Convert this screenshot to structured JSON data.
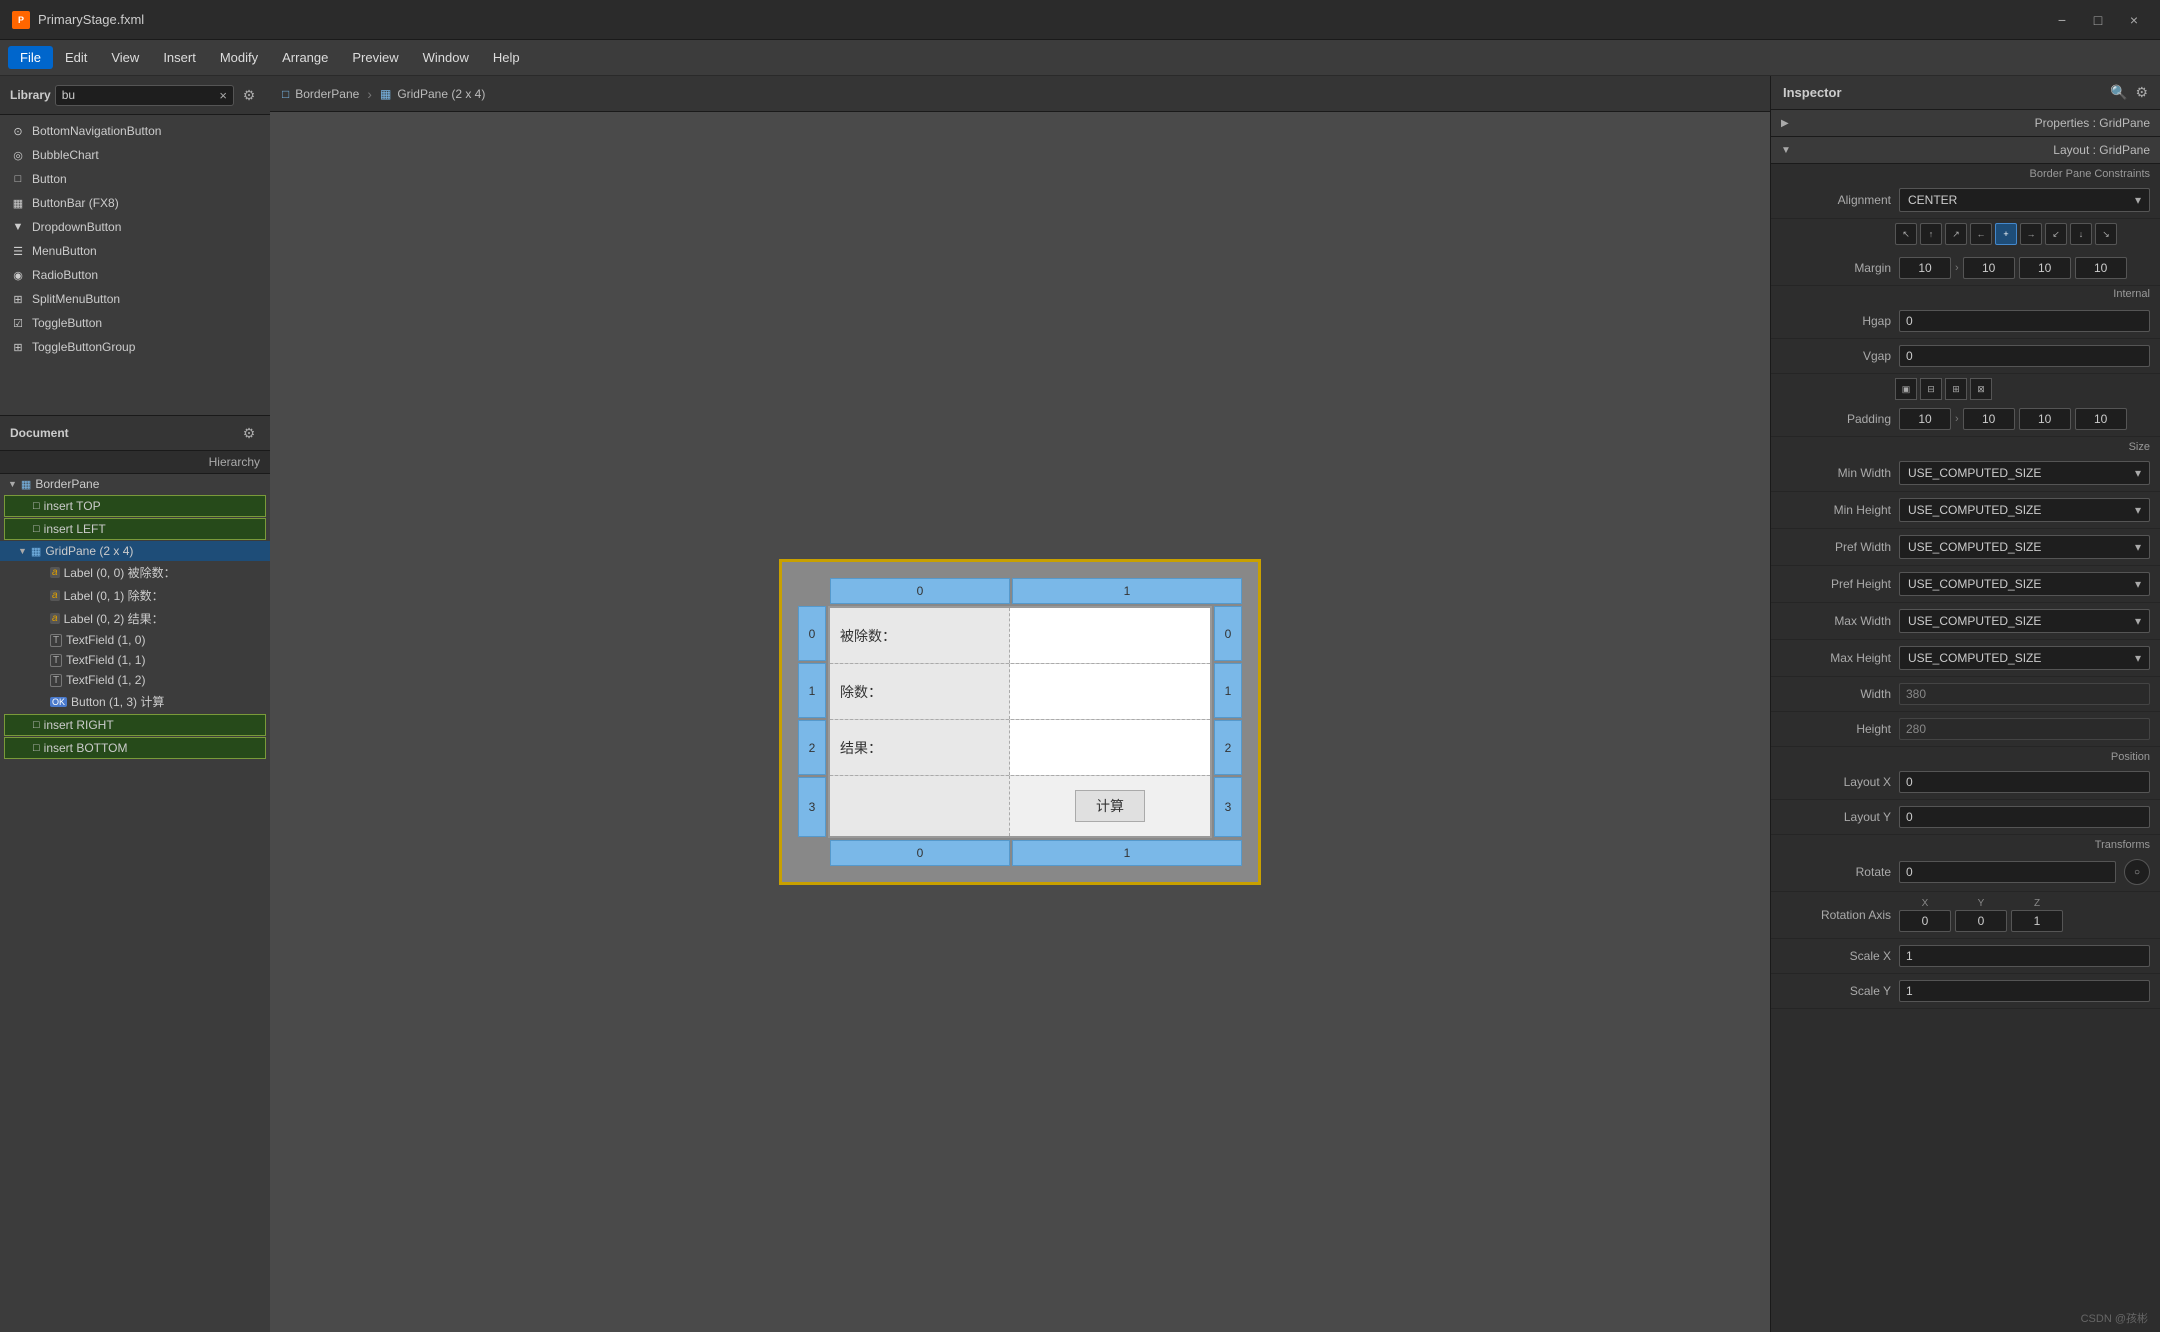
{
  "titlebar": {
    "title": "PrimaryStage.fxml",
    "icon": "P",
    "min_label": "−",
    "max_label": "□",
    "close_label": "×"
  },
  "menubar": {
    "items": [
      "File",
      "Edit",
      "View",
      "Insert",
      "Modify",
      "Arrange",
      "Preview",
      "Window",
      "Help"
    ],
    "active": "File"
  },
  "library": {
    "panel_title": "Library",
    "search_placeholder": "bu",
    "items": [
      {
        "icon": "⊙",
        "label": "BottomNavigationButton"
      },
      {
        "icon": "◎",
        "label": "BubbleChart"
      },
      {
        "icon": "□",
        "label": "Button"
      },
      {
        "icon": "▦",
        "label": "ButtonBar  (FX8)"
      },
      {
        "icon": "▼",
        "label": "DropdownButton"
      },
      {
        "icon": "☰",
        "label": "MenuButton"
      },
      {
        "icon": "◉",
        "label": "RadioButton"
      },
      {
        "icon": "⊞",
        "label": "SplitMenuButton"
      },
      {
        "icon": "☑",
        "label": "ToggleButton"
      },
      {
        "icon": "⊞",
        "label": "ToggleButtonGroup"
      }
    ]
  },
  "document": {
    "panel_title": "Document",
    "col_label": "Hierarchy",
    "tree": [
      {
        "indent": 0,
        "label": "BorderPane",
        "icon": "▼",
        "type": "container"
      },
      {
        "indent": 1,
        "label": "insert TOP",
        "icon": "□",
        "type": "placeholder",
        "highlighted": true
      },
      {
        "indent": 1,
        "label": "insert LEFT",
        "icon": "□",
        "type": "placeholder",
        "highlighted": true
      },
      {
        "indent": 1,
        "label": "GridPane (2 x 4)",
        "icon": "▦",
        "type": "gridpane",
        "selected": true
      },
      {
        "indent": 2,
        "label": "Label (0, 0)  被除数：",
        "icon": "a",
        "type": "label"
      },
      {
        "indent": 2,
        "label": "Label (0, 1)  除数：",
        "icon": "a",
        "type": "label"
      },
      {
        "indent": 2,
        "label": "Label (0, 2)  结果：",
        "icon": "a",
        "type": "label"
      },
      {
        "indent": 2,
        "label": "TextField (1, 0)",
        "icon": "T",
        "type": "textfield"
      },
      {
        "indent": 2,
        "label": "TextField (1, 1)",
        "icon": "T",
        "type": "textfield"
      },
      {
        "indent": 2,
        "label": "TextField (1, 2)",
        "icon": "T",
        "type": "textfield"
      },
      {
        "indent": 2,
        "label": "Button (1, 3)  计算",
        "icon": "OK",
        "type": "button"
      },
      {
        "indent": 1,
        "label": "insert RIGHT",
        "icon": "□",
        "type": "placeholder",
        "highlighted": true
      },
      {
        "indent": 1,
        "label": "insert BOTTOM",
        "icon": "□",
        "type": "placeholder",
        "highlighted": true
      }
    ]
  },
  "breadcrumb": {
    "items": [
      {
        "icon": "□",
        "label": "BorderPane"
      },
      {
        "icon": "▦",
        "label": "GridPane (2 x 4)"
      }
    ]
  },
  "canvas": {
    "grid": {
      "col_headers": [
        "0",
        "1"
      ],
      "row_headers": [
        "0",
        "1",
        "2",
        "3"
      ],
      "cells": [
        [
          {
            "type": "label",
            "text": "被除数："
          },
          {
            "type": "input",
            "text": ""
          }
        ],
        [
          {
            "type": "label",
            "text": "除数："
          },
          {
            "type": "input",
            "text": ""
          }
        ],
        [
          {
            "type": "label",
            "text": "结果："
          },
          {
            "type": "input",
            "text": ""
          }
        ],
        [
          {
            "type": "empty",
            "text": ""
          },
          {
            "type": "button",
            "text": "计算"
          }
        ]
      ]
    }
  },
  "inspector": {
    "title": "Inspector",
    "properties_label": "Properties : GridPane",
    "layout_label": "Layout : GridPane",
    "sections": {
      "border_pane_constraints": "Border Pane Constraints",
      "size_label": "Size",
      "position_label": "Position",
      "transforms_label": "Transforms",
      "internal_label": "Internal"
    },
    "alignment": {
      "label": "Alignment",
      "value": "CENTER",
      "options": [
        "CENTER",
        "TOP_LEFT",
        "TOP_CENTER",
        "TOP_RIGHT",
        "CENTER_LEFT",
        "CENTER_RIGHT",
        "BOTTOM_LEFT",
        "BOTTOM_CENTER",
        "BOTTOM_RIGHT"
      ]
    },
    "margin": {
      "label": "Margin",
      "top": "10",
      "right": "10",
      "bottom": "10",
      "left": "10"
    },
    "hgap": {
      "label": "Hgap",
      "value": "0"
    },
    "vgap": {
      "label": "Vgap",
      "value": "0"
    },
    "padding": {
      "label": "Padding",
      "top": "10",
      "right": "10",
      "bottom": "10",
      "left": "10"
    },
    "min_width": {
      "label": "Min Width",
      "value": "USE_COMPUTED_SIZE"
    },
    "min_height": {
      "label": "Min Height",
      "value": "USE_COMPUTED_SIZE"
    },
    "pref_width": {
      "label": "Pref Width",
      "value": "USE_COMPUTED_SIZE"
    },
    "pref_height": {
      "label": "Pref Height",
      "value": "USE_COMPUTED_SIZE"
    },
    "max_width": {
      "label": "Max Width",
      "value": "USE_COMPUTED_SIZE"
    },
    "max_height": {
      "label": "Max Height",
      "value": "USE_COMPUTED_SIZE"
    },
    "width": {
      "label": "Width",
      "value": "380"
    },
    "height": {
      "label": "Height",
      "value": "280"
    },
    "layout_x": {
      "label": "Layout X",
      "value": "0"
    },
    "layout_y": {
      "label": "Layout Y",
      "value": "0"
    },
    "rotate": {
      "label": "Rotate",
      "value": "0"
    },
    "rotation_axis": {
      "label": "Rotation Axis",
      "x": "0",
      "y": "0",
      "z": "1"
    },
    "scale_x": {
      "label": "Scale X",
      "value": "1"
    },
    "scale_y": {
      "label": "Scale Y",
      "value": "1"
    }
  }
}
